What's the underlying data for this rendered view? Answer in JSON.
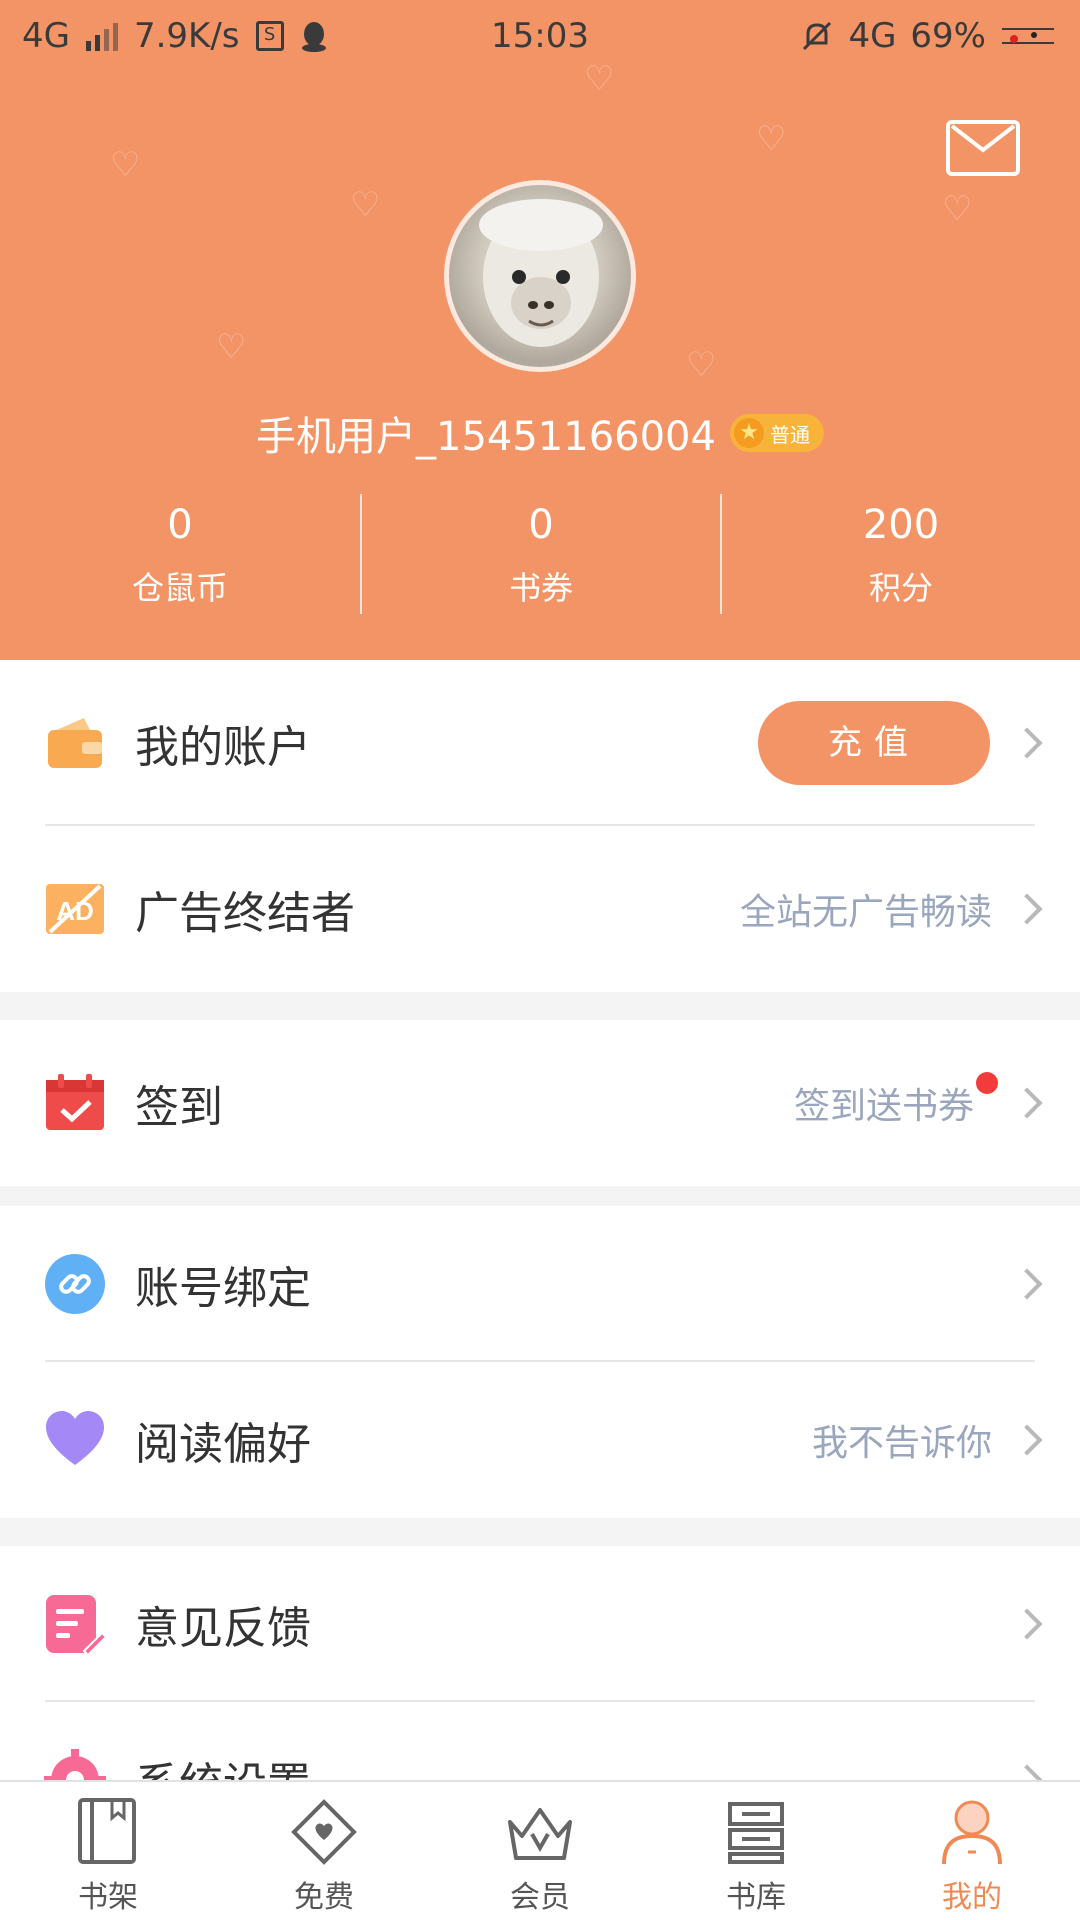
{
  "status_bar": {
    "network_left": "4G",
    "speed": "7.9K/s",
    "time": "15:03",
    "network_right": "4G",
    "battery": "69%"
  },
  "profile": {
    "username": "手机用户_15451166004",
    "badge": "普通",
    "stats": [
      {
        "value": "0",
        "label": "仓鼠币"
      },
      {
        "value": "0",
        "label": "书券"
      },
      {
        "value": "200",
        "label": "积分"
      }
    ]
  },
  "menu": {
    "account": {
      "label": "我的账户",
      "button": "充值"
    },
    "ad_killer": {
      "label": "广告终结者",
      "hint": "全站无广告畅读"
    },
    "checkin": {
      "label": "签到",
      "hint": "签到送书券"
    },
    "binding": {
      "label": "账号绑定"
    },
    "preference": {
      "label": "阅读偏好",
      "hint": "我不告诉你"
    },
    "feedback": {
      "label": "意见反馈"
    },
    "settings": {
      "label": "系统设置"
    }
  },
  "tabs": [
    {
      "label": "书架",
      "icon": "bookshelf-icon"
    },
    {
      "label": "免费",
      "icon": "free-ticket-icon"
    },
    {
      "label": "会员",
      "icon": "crown-icon"
    },
    {
      "label": "书库",
      "icon": "library-icon"
    },
    {
      "label": "我的",
      "icon": "user-icon",
      "active": true
    }
  ],
  "colors": {
    "accent": "#f39467",
    "active_tab": "#f08a55",
    "hint": "#9aa6bd",
    "notification_dot": "#f23b3b"
  }
}
